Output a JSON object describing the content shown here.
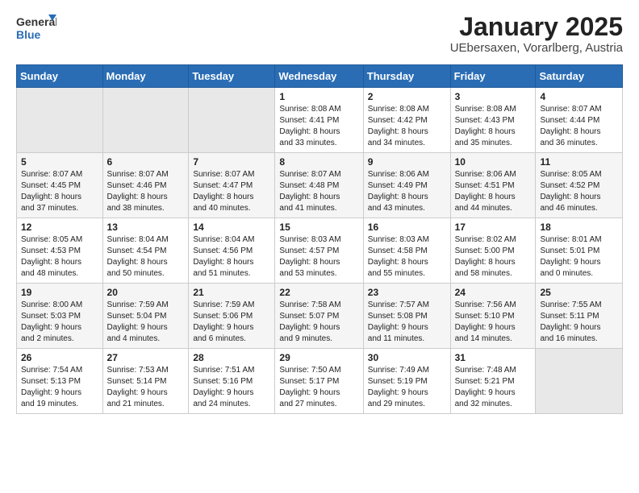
{
  "header": {
    "logo_general": "General",
    "logo_blue": "Blue",
    "title": "January 2025",
    "subtitle": "UEbersaxen, Vorarlberg, Austria"
  },
  "weekdays": [
    "Sunday",
    "Monday",
    "Tuesday",
    "Wednesday",
    "Thursday",
    "Friday",
    "Saturday"
  ],
  "weeks": [
    [
      {
        "day": "",
        "info": ""
      },
      {
        "day": "",
        "info": ""
      },
      {
        "day": "",
        "info": ""
      },
      {
        "day": "1",
        "info": "Sunrise: 8:08 AM\nSunset: 4:41 PM\nDaylight: 8 hours\nand 33 minutes."
      },
      {
        "day": "2",
        "info": "Sunrise: 8:08 AM\nSunset: 4:42 PM\nDaylight: 8 hours\nand 34 minutes."
      },
      {
        "day": "3",
        "info": "Sunrise: 8:08 AM\nSunset: 4:43 PM\nDaylight: 8 hours\nand 35 minutes."
      },
      {
        "day": "4",
        "info": "Sunrise: 8:07 AM\nSunset: 4:44 PM\nDaylight: 8 hours\nand 36 minutes."
      }
    ],
    [
      {
        "day": "5",
        "info": "Sunrise: 8:07 AM\nSunset: 4:45 PM\nDaylight: 8 hours\nand 37 minutes."
      },
      {
        "day": "6",
        "info": "Sunrise: 8:07 AM\nSunset: 4:46 PM\nDaylight: 8 hours\nand 38 minutes."
      },
      {
        "day": "7",
        "info": "Sunrise: 8:07 AM\nSunset: 4:47 PM\nDaylight: 8 hours\nand 40 minutes."
      },
      {
        "day": "8",
        "info": "Sunrise: 8:07 AM\nSunset: 4:48 PM\nDaylight: 8 hours\nand 41 minutes."
      },
      {
        "day": "9",
        "info": "Sunrise: 8:06 AM\nSunset: 4:49 PM\nDaylight: 8 hours\nand 43 minutes."
      },
      {
        "day": "10",
        "info": "Sunrise: 8:06 AM\nSunset: 4:51 PM\nDaylight: 8 hours\nand 44 minutes."
      },
      {
        "day": "11",
        "info": "Sunrise: 8:05 AM\nSunset: 4:52 PM\nDaylight: 8 hours\nand 46 minutes."
      }
    ],
    [
      {
        "day": "12",
        "info": "Sunrise: 8:05 AM\nSunset: 4:53 PM\nDaylight: 8 hours\nand 48 minutes."
      },
      {
        "day": "13",
        "info": "Sunrise: 8:04 AM\nSunset: 4:54 PM\nDaylight: 8 hours\nand 50 minutes."
      },
      {
        "day": "14",
        "info": "Sunrise: 8:04 AM\nSunset: 4:56 PM\nDaylight: 8 hours\nand 51 minutes."
      },
      {
        "day": "15",
        "info": "Sunrise: 8:03 AM\nSunset: 4:57 PM\nDaylight: 8 hours\nand 53 minutes."
      },
      {
        "day": "16",
        "info": "Sunrise: 8:03 AM\nSunset: 4:58 PM\nDaylight: 8 hours\nand 55 minutes."
      },
      {
        "day": "17",
        "info": "Sunrise: 8:02 AM\nSunset: 5:00 PM\nDaylight: 8 hours\nand 58 minutes."
      },
      {
        "day": "18",
        "info": "Sunrise: 8:01 AM\nSunset: 5:01 PM\nDaylight: 9 hours\nand 0 minutes."
      }
    ],
    [
      {
        "day": "19",
        "info": "Sunrise: 8:00 AM\nSunset: 5:03 PM\nDaylight: 9 hours\nand 2 minutes."
      },
      {
        "day": "20",
        "info": "Sunrise: 7:59 AM\nSunset: 5:04 PM\nDaylight: 9 hours\nand 4 minutes."
      },
      {
        "day": "21",
        "info": "Sunrise: 7:59 AM\nSunset: 5:06 PM\nDaylight: 9 hours\nand 6 minutes."
      },
      {
        "day": "22",
        "info": "Sunrise: 7:58 AM\nSunset: 5:07 PM\nDaylight: 9 hours\nand 9 minutes."
      },
      {
        "day": "23",
        "info": "Sunrise: 7:57 AM\nSunset: 5:08 PM\nDaylight: 9 hours\nand 11 minutes."
      },
      {
        "day": "24",
        "info": "Sunrise: 7:56 AM\nSunset: 5:10 PM\nDaylight: 9 hours\nand 14 minutes."
      },
      {
        "day": "25",
        "info": "Sunrise: 7:55 AM\nSunset: 5:11 PM\nDaylight: 9 hours\nand 16 minutes."
      }
    ],
    [
      {
        "day": "26",
        "info": "Sunrise: 7:54 AM\nSunset: 5:13 PM\nDaylight: 9 hours\nand 19 minutes."
      },
      {
        "day": "27",
        "info": "Sunrise: 7:53 AM\nSunset: 5:14 PM\nDaylight: 9 hours\nand 21 minutes."
      },
      {
        "day": "28",
        "info": "Sunrise: 7:51 AM\nSunset: 5:16 PM\nDaylight: 9 hours\nand 24 minutes."
      },
      {
        "day": "29",
        "info": "Sunrise: 7:50 AM\nSunset: 5:17 PM\nDaylight: 9 hours\nand 27 minutes."
      },
      {
        "day": "30",
        "info": "Sunrise: 7:49 AM\nSunset: 5:19 PM\nDaylight: 9 hours\nand 29 minutes."
      },
      {
        "day": "31",
        "info": "Sunrise: 7:48 AM\nSunset: 5:21 PM\nDaylight: 9 hours\nand 32 minutes."
      },
      {
        "day": "",
        "info": ""
      }
    ]
  ]
}
